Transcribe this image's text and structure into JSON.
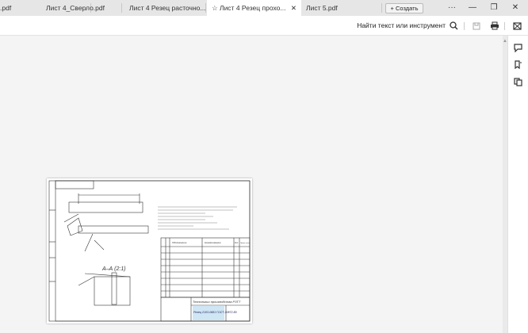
{
  "tabs": [
    {
      "label": ".pdf"
    },
    {
      "label": "Лист 4_Сверло.pdf"
    },
    {
      "label": "Лист 4 Резец расточно..."
    },
    {
      "label": "Лист 4 Резец прохо...",
      "active": true
    },
    {
      "label": "Лист 5.pdf"
    }
  ],
  "create_label": "+ Создать",
  "window": {
    "more": "···",
    "minimize": "—",
    "restore": "❐",
    "close": "✕"
  },
  "toolbar": {
    "find_label": "Найти текст или инструмент"
  },
  "drawing": {
    "title": "Технологии производства РЗТТ",
    "part": "Резец 2103-0681 ГОСТ 20872-80",
    "section": "А–А (2:1)",
    "table_headers": [
      "Обозначение",
      "Наименование",
      "Кол.",
      "Приме-чание"
    ]
  }
}
